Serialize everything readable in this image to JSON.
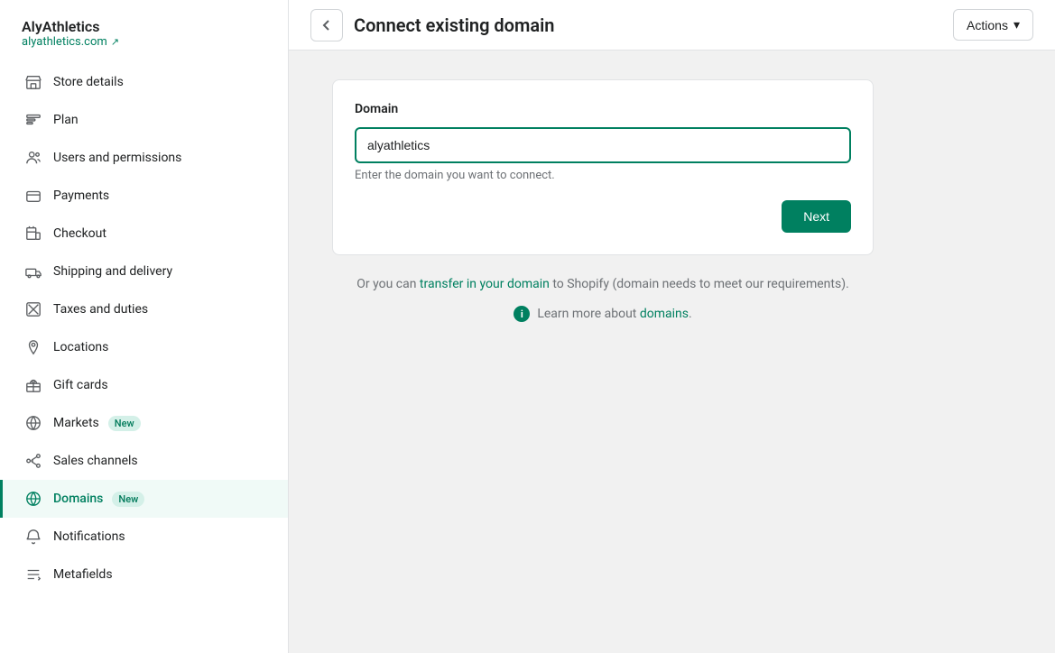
{
  "sidebar": {
    "store_name": "AlyAthletics",
    "store_link": "alyathletics.com",
    "store_link_icon": "external-link-icon",
    "nav_items": [
      {
        "id": "store-details",
        "label": "Store details",
        "icon": "store-icon",
        "active": false,
        "badge": null
      },
      {
        "id": "plan",
        "label": "Plan",
        "icon": "plan-icon",
        "active": false,
        "badge": null
      },
      {
        "id": "users-permissions",
        "label": "Users and permissions",
        "icon": "users-icon",
        "active": false,
        "badge": null
      },
      {
        "id": "payments",
        "label": "Payments",
        "icon": "payments-icon",
        "active": false,
        "badge": null
      },
      {
        "id": "checkout",
        "label": "Checkout",
        "icon": "checkout-icon",
        "active": false,
        "badge": null
      },
      {
        "id": "shipping-delivery",
        "label": "Shipping and delivery",
        "icon": "shipping-icon",
        "active": false,
        "badge": null
      },
      {
        "id": "taxes-duties",
        "label": "Taxes and duties",
        "icon": "taxes-icon",
        "active": false,
        "badge": null
      },
      {
        "id": "locations",
        "label": "Locations",
        "icon": "locations-icon",
        "active": false,
        "badge": null
      },
      {
        "id": "gift-cards",
        "label": "Gift cards",
        "icon": "gift-icon",
        "active": false,
        "badge": null
      },
      {
        "id": "markets",
        "label": "Markets",
        "icon": "markets-icon",
        "active": false,
        "badge": "New"
      },
      {
        "id": "sales-channels",
        "label": "Sales channels",
        "icon": "channels-icon",
        "active": false,
        "badge": null
      },
      {
        "id": "domains",
        "label": "Domains",
        "icon": "domains-icon",
        "active": true,
        "badge": "New"
      },
      {
        "id": "notifications",
        "label": "Notifications",
        "icon": "notifications-icon",
        "active": false,
        "badge": null
      },
      {
        "id": "metafields",
        "label": "Metafields",
        "icon": "metafields-icon",
        "active": false,
        "badge": null
      }
    ]
  },
  "topbar": {
    "back_button_label": "←",
    "page_title": "Connect existing domain",
    "actions_label": "Actions",
    "actions_chevron": "▾"
  },
  "domain_card": {
    "title": "Domain",
    "input_value": "alyathletics",
    "input_placeholder": "",
    "hint_text": "Enter the domain you want to connect.",
    "next_button_label": "Next"
  },
  "transfer_text": {
    "prefix": "Or you can ",
    "link_text": "transfer in your domain",
    "suffix": " to Shopify (domain needs to meet our requirements)."
  },
  "learn_more": {
    "prefix": "Learn more about ",
    "link_text": "domains",
    "suffix": ".",
    "info_icon_label": "i"
  }
}
